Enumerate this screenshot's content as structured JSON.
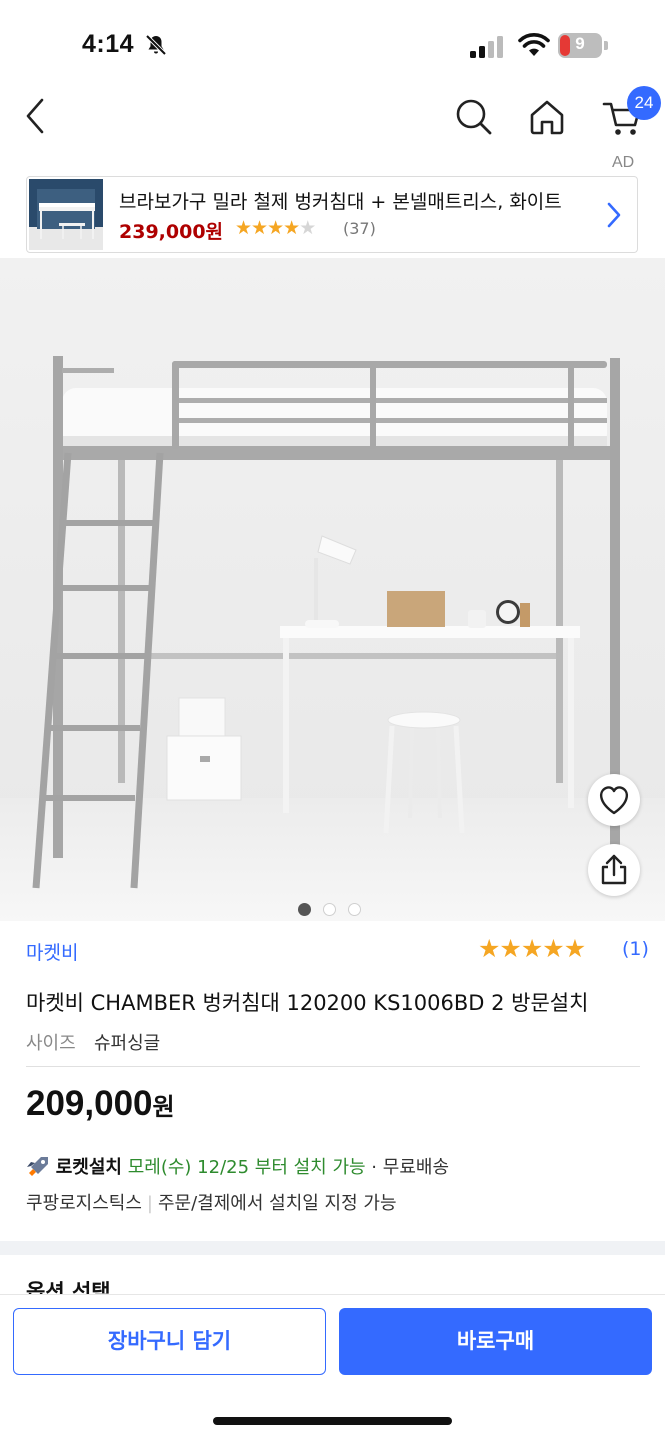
{
  "status_bar": {
    "time": "4:14",
    "battery": "9"
  },
  "nav": {
    "cart_count": "24"
  },
  "ad": {
    "label": "AD",
    "title": "브라보가구 밀라 철제 벙커침대 + 본넬매트리스, 화이트",
    "price": "239,000원",
    "review_count": "(37)",
    "rating_stars": 4
  },
  "gallery": {
    "total": 3,
    "current": 1
  },
  "product": {
    "brand": "마켓비",
    "rating_count": "(1)",
    "rating_stars": 5,
    "title": "마켓비 CHAMBER 벙커침대 120200 KS1006BD 2 방문설치",
    "option_label": "사이즈",
    "option_value": "슈퍼싱글",
    "price_number": "209,000",
    "price_unit": "원"
  },
  "delivery": {
    "rocket_label": "로켓설치",
    "date_text": "모레(수) 12/25 부터 설치 가능",
    "bullet": "·",
    "free_shipping": "무료배송",
    "logistics": "쿠팡로지스틱스",
    "separator": "|",
    "schedule_note": "주문/결제에서 설치일 지정 가능"
  },
  "section": {
    "title": "옵션 선택"
  },
  "actions": {
    "cart_button": "장바구니 담기",
    "buy_button": "바로구매"
  },
  "colors": {
    "accent": "#346aff",
    "star": "#f5a623",
    "ad_price": "#ae0000",
    "delivery_green": "#2e8b2e"
  }
}
